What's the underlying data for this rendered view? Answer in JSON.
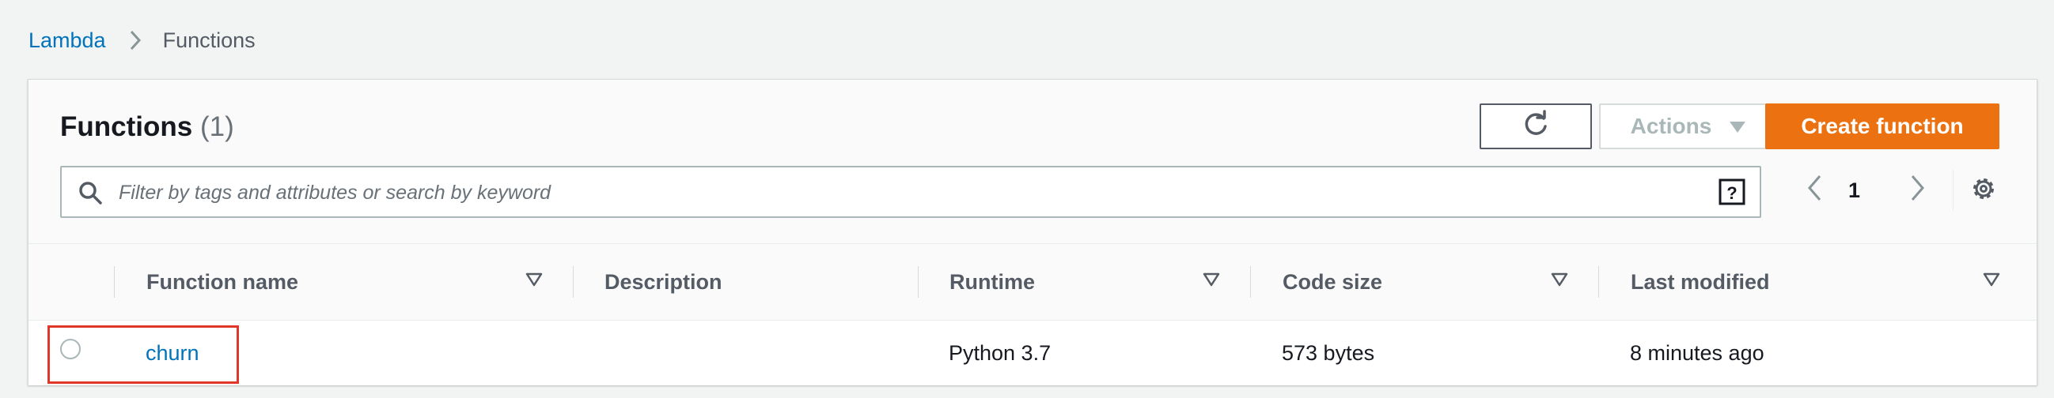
{
  "breadcrumb": {
    "root": "Lambda",
    "current": "Functions"
  },
  "panel": {
    "title": "Functions",
    "count": "(1)",
    "actions_label": "Actions",
    "create_label": "Create function"
  },
  "search": {
    "placeholder": "Filter by tags and attributes or search by keyword"
  },
  "pagination": {
    "page": "1"
  },
  "table": {
    "headers": [
      "Function name",
      "Description",
      "Runtime",
      "Code size",
      "Last modified"
    ],
    "rows": [
      {
        "name": "churn",
        "description": "",
        "runtime": "Python 3.7",
        "code_size": "573 bytes",
        "last_modified": "8 minutes ago"
      }
    ]
  },
  "colors": {
    "accent": "#ec7211",
    "link": "#0073bb",
    "highlight": "#e1372b"
  },
  "icons": [
    "chevron-right-icon",
    "refresh-icon",
    "caret-down-icon",
    "search-icon",
    "help-icon",
    "chevron-left-icon",
    "gear-icon",
    "sort-icon"
  ]
}
